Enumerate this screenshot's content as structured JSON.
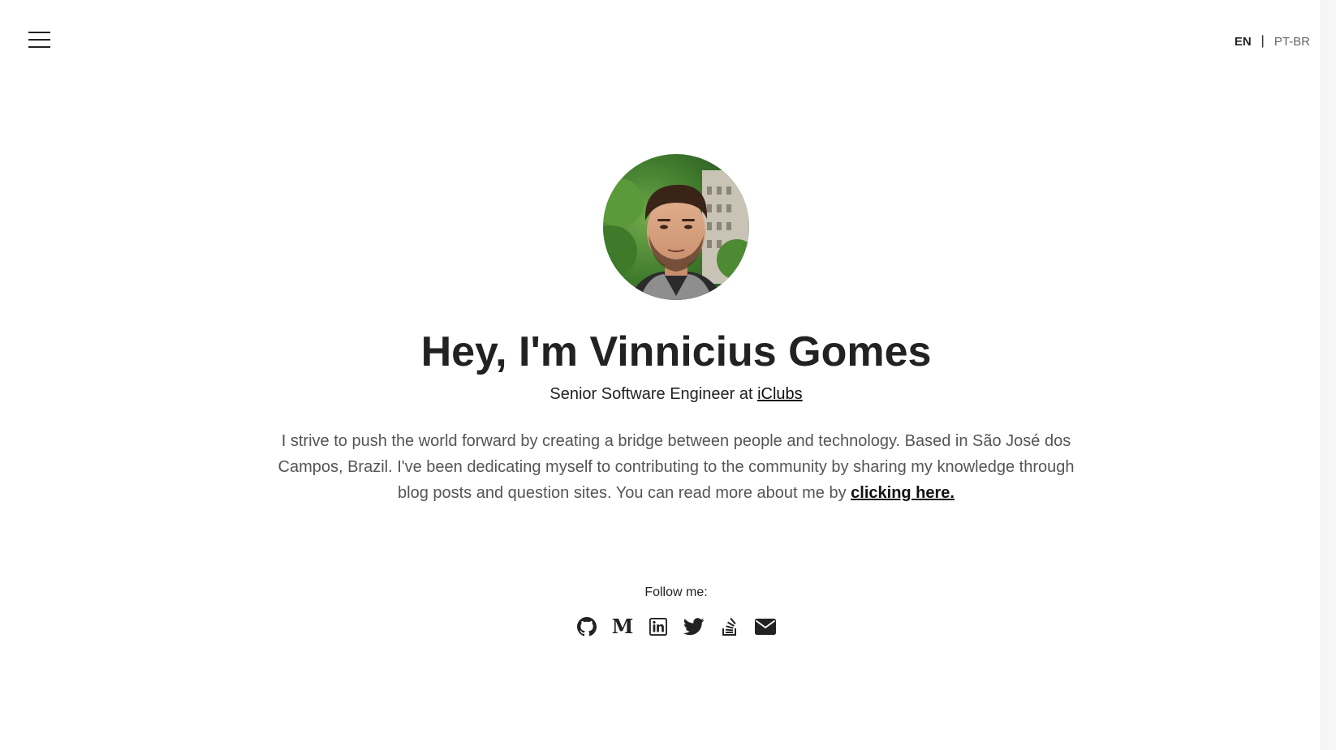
{
  "header": {
    "menu_icon": "hamburger-menu-icon",
    "languages": {
      "active": "EN",
      "separator": "|",
      "other": "PT-BR"
    }
  },
  "profile": {
    "avatar_alt": "Vinnicius Gomes",
    "title": "Hey, I'm Vinnicius Gomes",
    "subtitle_prefix": "Senior Software Engineer at ",
    "company_link": "iClubs",
    "bio_text": "I strive to push the world forward by creating a bridge between people and technology. Based in São José dos Campos, Brazil. I've been dedicating myself to contributing to the community by sharing my knowledge through blog posts and question sites. You can read more about me by ",
    "bio_link": "clicking here."
  },
  "social": {
    "label": "Follow me:",
    "links": [
      {
        "name": "GitHub",
        "icon": "github-icon"
      },
      {
        "name": "Medium",
        "icon": "medium-icon",
        "glyph": "M"
      },
      {
        "name": "LinkedIn",
        "icon": "linkedin-icon"
      },
      {
        "name": "Twitter",
        "icon": "twitter-icon"
      },
      {
        "name": "Stack Overflow",
        "icon": "stackoverflow-icon"
      },
      {
        "name": "Email",
        "icon": "email-icon"
      }
    ]
  },
  "colors": {
    "text": "#222222",
    "muted": "#555555",
    "background": "#ffffff"
  }
}
